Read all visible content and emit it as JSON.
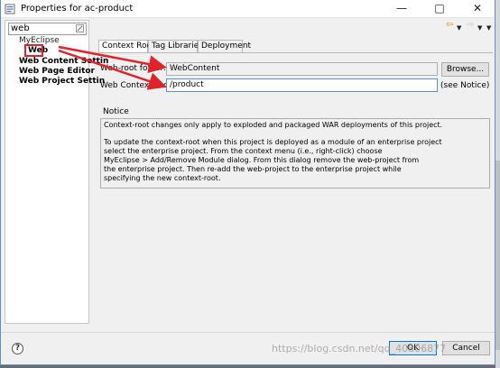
{
  "window": {
    "title": "Properties for ac-product",
    "minimize": "—",
    "maximize": "□",
    "close": "✕",
    "title_icon": "properties-icon"
  },
  "left_panel": {
    "filter_value": "web",
    "filter_clear_icon": "clear-filter-icon",
    "tree": {
      "myeclipse": "MyEclipse",
      "web": "Web",
      "web_content_settings": "Web Content Settin",
      "web_page_editor": "Web Page Editor",
      "web_project_settings": "Web Project Settin"
    }
  },
  "nav": {
    "back": "⇦",
    "forward": "⇨",
    "dropdown": "▼",
    "menu": "▼"
  },
  "tabs": [
    "Context Root",
    "Tag Libraries",
    "Deployment"
  ],
  "form": {
    "web_root_label": "Web-root folder:",
    "web_root_value": "WebContent",
    "browse_label": "Browse...",
    "context_root_label": "Web Context-root:",
    "context_root_value": "/product",
    "see_notice": "(see Notice)"
  },
  "notice": {
    "heading": "Notice",
    "line1": "Context-root changes only apply to exploded and packaged WAR deployments of this project.",
    "para2": "To update the context-root when this project is deployed as a module of an enterprise project\nselect the enterprise project. From the context menu (i.e., right-click) choose\nMyEclipse > Add/Remove Module dialog. From this dialog remove the web-project from\nthe enterprise project. Then re-add the web-project to the enterprise project while\nspecifying the new context-root."
  },
  "footer": {
    "help": "?",
    "ok": "OK",
    "cancel": "Cancel",
    "watermark": "https://blog.csdn.net/qq_40806877"
  },
  "colors": {
    "annotation": "#e0222a",
    "accent": "#0078d7"
  }
}
